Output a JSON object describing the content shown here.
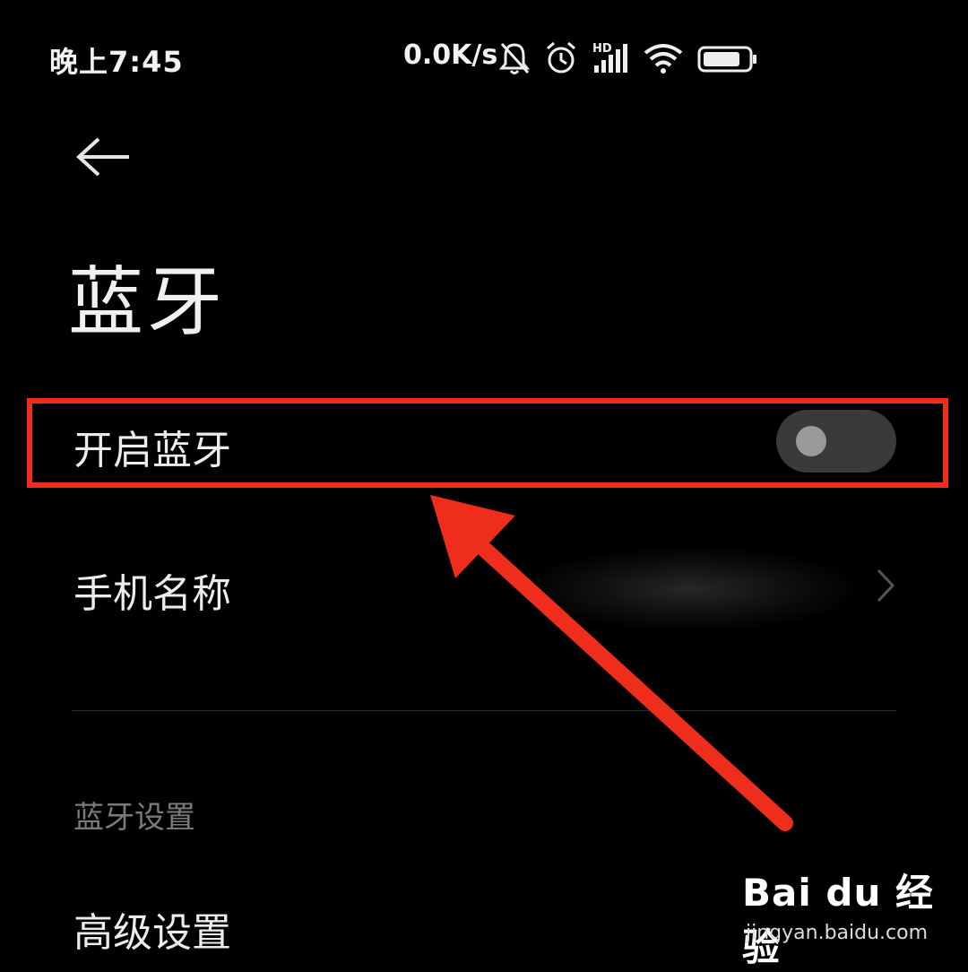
{
  "status_bar": {
    "time": "晚上7:45",
    "net_speed": "0.0K/s",
    "signal_label": "HD",
    "icons": [
      "mute-bell-icon",
      "alarm-icon",
      "hd-signal-icon",
      "wifi-icon",
      "battery-icon"
    ]
  },
  "page": {
    "title": "蓝牙",
    "back_icon": "back-arrow-icon"
  },
  "settings": {
    "bluetooth_toggle": {
      "label": "开启蓝牙",
      "enabled": false
    },
    "phone_name": {
      "label": "手机名称"
    },
    "section_header": "蓝牙设置",
    "advanced": {
      "label": "高级设置"
    }
  },
  "annotation": {
    "highlight_color": "#ee2d1c",
    "arrow_color": "#ee2d1c"
  },
  "watermark": {
    "brand": "Bai du 经验",
    "url": "jingyan.baidu.com"
  }
}
